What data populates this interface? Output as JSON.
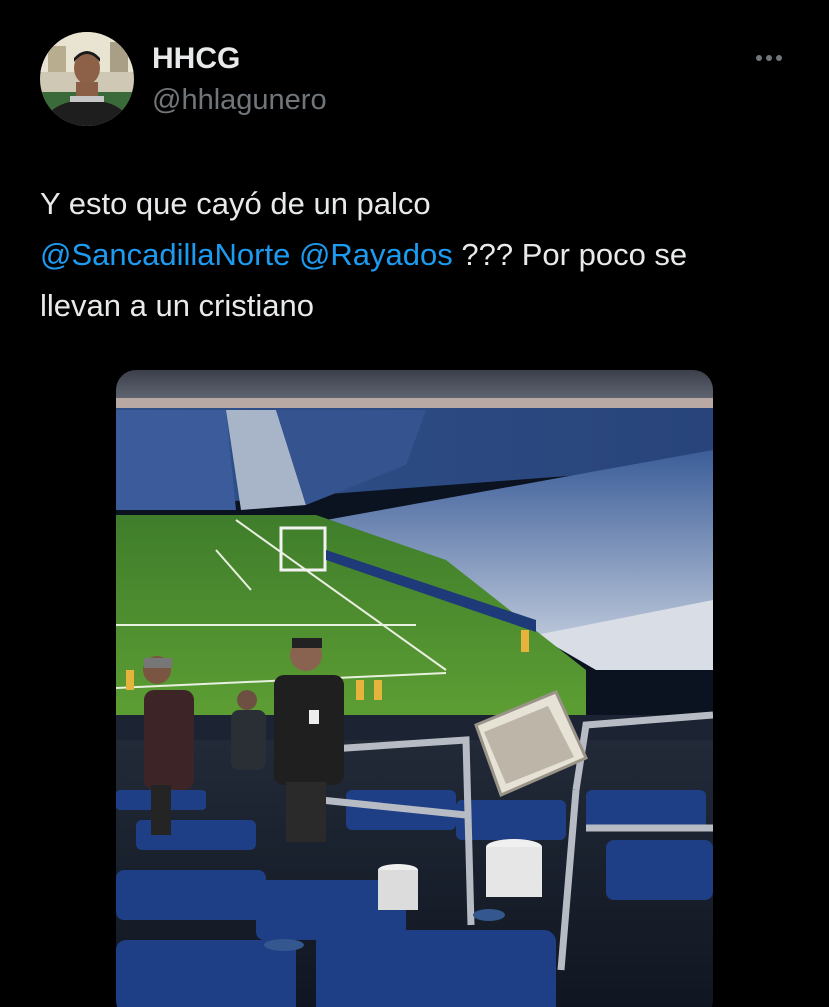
{
  "author": {
    "display_name": "HHCG",
    "handle": "@hhlagunero",
    "avatar_icon": "profile-photo"
  },
  "more_icon": "more-horizontal-icon",
  "tweet": {
    "line1": "Y esto que cayó de un palco",
    "mention1": "@SancadillaNorte",
    "mention2": "@Rayados",
    "line2_rest": " ??? Por poco se",
    "line3": "llevan a un cristiano"
  },
  "media": {
    "description_icon": "stadium-photo"
  },
  "colors": {
    "background": "#000000",
    "text": "#e7e9ea",
    "secondary_text": "#71767b",
    "mention": "#1d9bf0"
  }
}
